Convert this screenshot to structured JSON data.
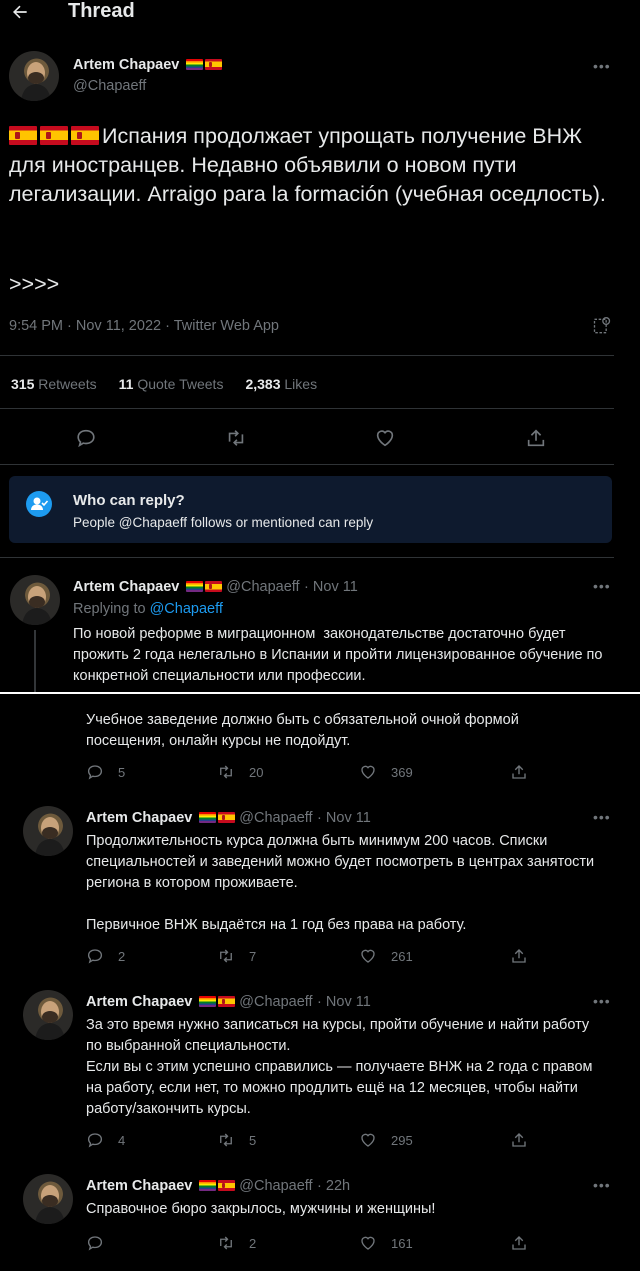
{
  "header": {
    "back_icon": "arrow-left-icon",
    "title": "Thread"
  },
  "main_tweet": {
    "author_name": "Artem Chapaev",
    "handle": "@Chapaeff",
    "text": "Испания продолжает упрощать получение ВНЖ для иностранцев. Недавно объявили о новом пути легализации. Arraigo para la formación (учебная оседлость).",
    "text2": ">>>>",
    "timestamp": "9:54 PM · Nov 11, 2022 · Twitter Web App",
    "stats": {
      "retweets_count": "315",
      "retweets_label": "Retweets",
      "quotes_count": "11",
      "quotes_label": "Quote Tweets",
      "likes_count": "2,383",
      "likes_label": "Likes"
    }
  },
  "who_can_reply": {
    "title": "Who can reply?",
    "text": "People @Chapaeff follows or mentioned can reply"
  },
  "replies": [
    {
      "author_name": "Artem Chapaev",
      "handle": "@Chapaeff",
      "time": "· Nov 11",
      "replying_prefix": "Replying to",
      "replying_to": "@Chapaeff",
      "text": "По новой реформе в миграционном  законодательстве достаточно будет прожить 2 года нелегально в Испании и пройти лицензированное обучение по конкретной специальности или профессии.",
      "text_cont": "Учебное заведение должно быть с обязательной очной формой посещения, онлайн курсы не подойдут.",
      "replies": "5",
      "retweets": "20",
      "likes": "369"
    },
    {
      "author_name": "Artem Chapaev",
      "handle": "@Chapaeff",
      "time": "· Nov 11",
      "text": "Продолжительность курса должна быть минимум 200 часов. Списки специальностей и заведений можно будет посмотреть в центрах занятости региона в котором проживаете.\n\nПервичное ВНЖ выдаётся на 1 год без права на работу.",
      "replies": "2",
      "retweets": "7",
      "likes": "261"
    },
    {
      "author_name": "Artem Chapaev",
      "handle": "@Chapaeff",
      "time": "· Nov 11",
      "text": "За это время нужно записаться на курсы, пройти обучение и найти работу по выбранной специальности.\nЕсли вы с этим успешно справились — получаете ВНЖ на 2 года с правом на работу, если нет, то можно продлить ещё на 12 месяцев, чтобы найти работу/закончить курсы.",
      "replies": "4",
      "retweets": "5",
      "likes": "295"
    },
    {
      "author_name": "Artem Chapaev",
      "handle": "@Chapaeff",
      "time": "· 22h",
      "text": "Справочное бюро закрылось, мужчины и женщины!",
      "replies": "",
      "retweets": "2",
      "likes": "161"
    }
  ],
  "colors": {
    "background": "#000000",
    "accent": "#1d9bf0",
    "muted": "#71767b",
    "reply_box": "#0e1a2e"
  }
}
